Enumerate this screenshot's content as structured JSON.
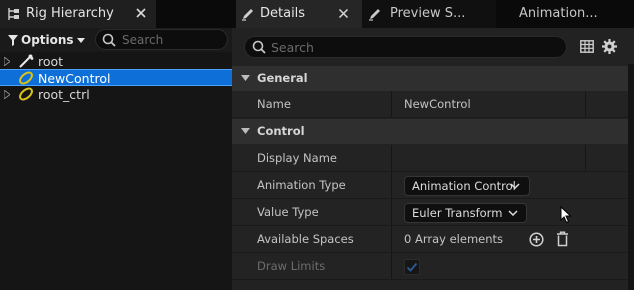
{
  "left_panel": {
    "tab_title": "Rig Hierarchy",
    "options_label": "Options",
    "search_placeholder": "Search",
    "tree": [
      {
        "label": "root",
        "icon": "bone-icon",
        "selected": false
      },
      {
        "label": "NewControl",
        "icon": "control-ring-icon",
        "selected": true
      },
      {
        "label": "root_ctrl",
        "icon": "control-ring-icon",
        "selected": false
      }
    ]
  },
  "right_panel": {
    "tabs": [
      {
        "label": "Details",
        "icon": "details-pencil-icon",
        "active": true
      },
      {
        "label": "Preview S...",
        "icon": "preview-pencil-icon",
        "active": false
      },
      {
        "label": "Animation...",
        "active": false
      }
    ],
    "search_placeholder": "Search",
    "sections": [
      {
        "title": "General",
        "properties": [
          {
            "name": "Name",
            "value": "NewControl"
          }
        ]
      },
      {
        "title": "Control",
        "properties": [
          {
            "name": "Display Name",
            "value": ""
          },
          {
            "name": "Animation Type",
            "value": "Animation Control"
          },
          {
            "name": "Value Type",
            "value": "Euler Transform"
          },
          {
            "name": "Available Spaces",
            "value": "0 Array elements"
          },
          {
            "name": "Draw Limits",
            "value": "",
            "checked": true,
            "disabled": true
          }
        ]
      }
    ]
  },
  "colors": {
    "selection": "#0f6fd8",
    "control_icon": "#d8c21a",
    "panel_bg": "#222222",
    "section_header": "#2f2f2f"
  }
}
